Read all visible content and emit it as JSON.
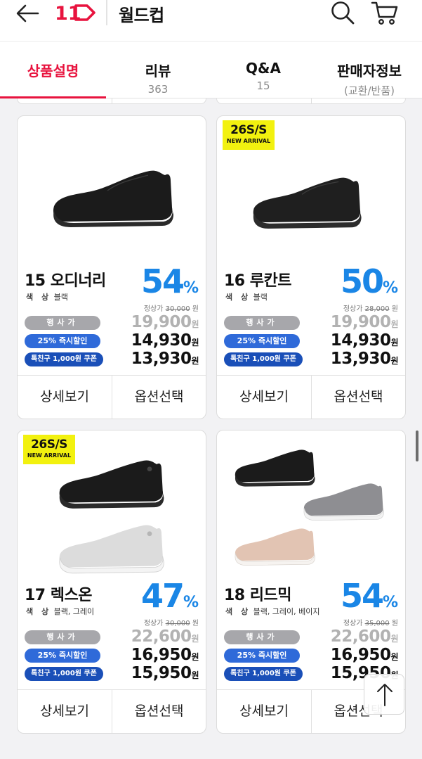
{
  "header": {
    "logo_text": "11",
    "title": "월드컵",
    "icons": {
      "back": "back-arrow-icon",
      "search": "search-icon",
      "cart": "cart-icon"
    }
  },
  "tabs": [
    {
      "label": "상품설명",
      "sub": ""
    },
    {
      "label": "리뷰",
      "sub": "363"
    },
    {
      "label": "Q&A",
      "sub": "15"
    },
    {
      "label": "판매자정보",
      "sub": "(교환/반품)"
    }
  ],
  "colors": {
    "accent": "#e8133e",
    "discount": "#1a86e6",
    "badge": "#f2f10f"
  },
  "pill_labels": {
    "regular": "행사가",
    "instant": "25% 즉시할인",
    "coupon": "톡친구 1,000원 쿠폰"
  },
  "color_label": "색 상",
  "orig_label": "정상가",
  "won": "원",
  "button_labels": {
    "detail": "상세보기",
    "option": "옵션선택"
  },
  "badge": {
    "line1": "26S/S",
    "line2": "NEW ARRIVAL"
  },
  "products": [
    {
      "name": "15 오디너리",
      "colors": "블랙",
      "discount": "54",
      "pct": "%",
      "orig_price": "30,000",
      "event_price": "19,900",
      "instant_price": "14,930",
      "coupon_price": "13,930",
      "badge": false
    },
    {
      "name": "16 루칸트",
      "colors": "블랙",
      "discount": "50",
      "pct": "%",
      "orig_price": "28,000",
      "event_price": "19,900",
      "instant_price": "14,930",
      "coupon_price": "13,930",
      "badge": true
    },
    {
      "name": "17 렉스온",
      "colors": "블랙, 그레이",
      "discount": "47",
      "pct": "%",
      "orig_price": "30,000",
      "event_price": "22,600",
      "instant_price": "16,950",
      "coupon_price": "15,950",
      "badge": true
    },
    {
      "name": "18 리드믹",
      "colors": "블랙, 그레이, 베이지",
      "discount": "54",
      "pct": "%",
      "orig_price": "35,000",
      "event_price": "22,600",
      "instant_price": "16,950",
      "coupon_price": "15,950",
      "badge": false
    }
  ],
  "scroll_top_icon": "arrow-up-icon"
}
